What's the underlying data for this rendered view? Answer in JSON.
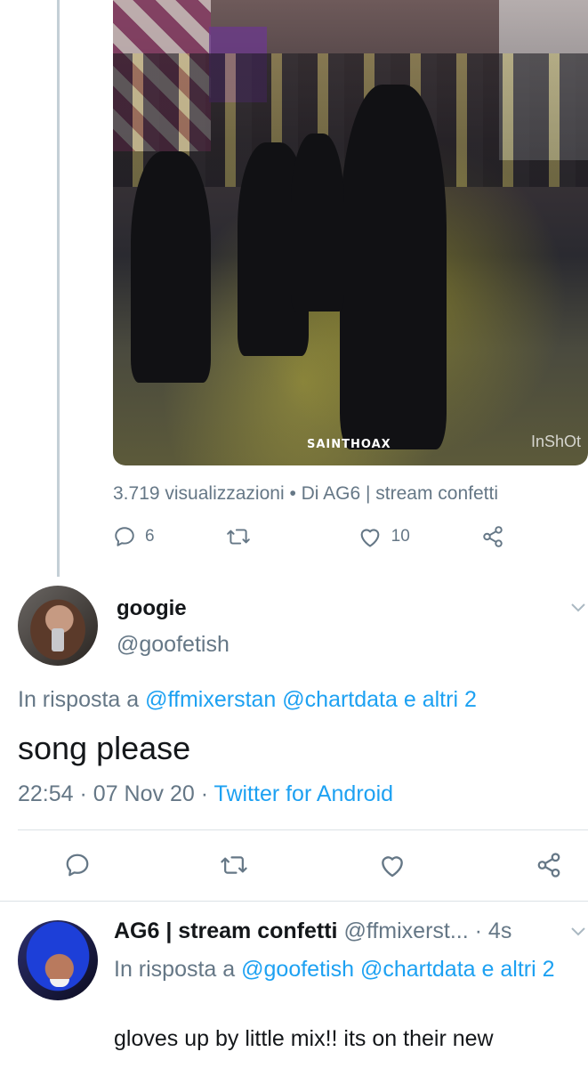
{
  "media": {
    "watermark_left": "SAINTHOAX",
    "watermark_right": "InShOt",
    "views_meta": "3.719 visualizzazioni • Di AG6 | stream confetti"
  },
  "first_tweet_actions": {
    "reply_count": "6",
    "retweet_count": "",
    "like_count": "10"
  },
  "reply_tweet": {
    "display_name": "googie",
    "handle": "@goofetish",
    "reply_prefix": "In risposta a",
    "reply_to_1": "@ffmixerstan",
    "reply_to_2": "@chartdata",
    "reply_and": "e",
    "reply_others": "altri 2",
    "text": "song please",
    "time": "22:54",
    "sep1": "·",
    "date": "07 Nov 20",
    "sep2": "·",
    "client": "Twitter for Android"
  },
  "next_tweet": {
    "display_name": "AG6 | stream confetti",
    "handle": "@ffmixerst...",
    "age": "· 4s",
    "reply_prefix": "In risposta a",
    "reply_to_1": "@goofetish",
    "reply_to_2": "@chartdata",
    "reply_and": "e",
    "reply_others": "altri 2",
    "text": "gloves up by little mix!! its on their new"
  },
  "icons": [
    "reply-icon",
    "retweet-icon",
    "like-icon",
    "share-icon",
    "chevron-down-icon"
  ],
  "colors": {
    "link": "#1da1f2",
    "secondary": "#657786",
    "primary": "#14171a"
  }
}
